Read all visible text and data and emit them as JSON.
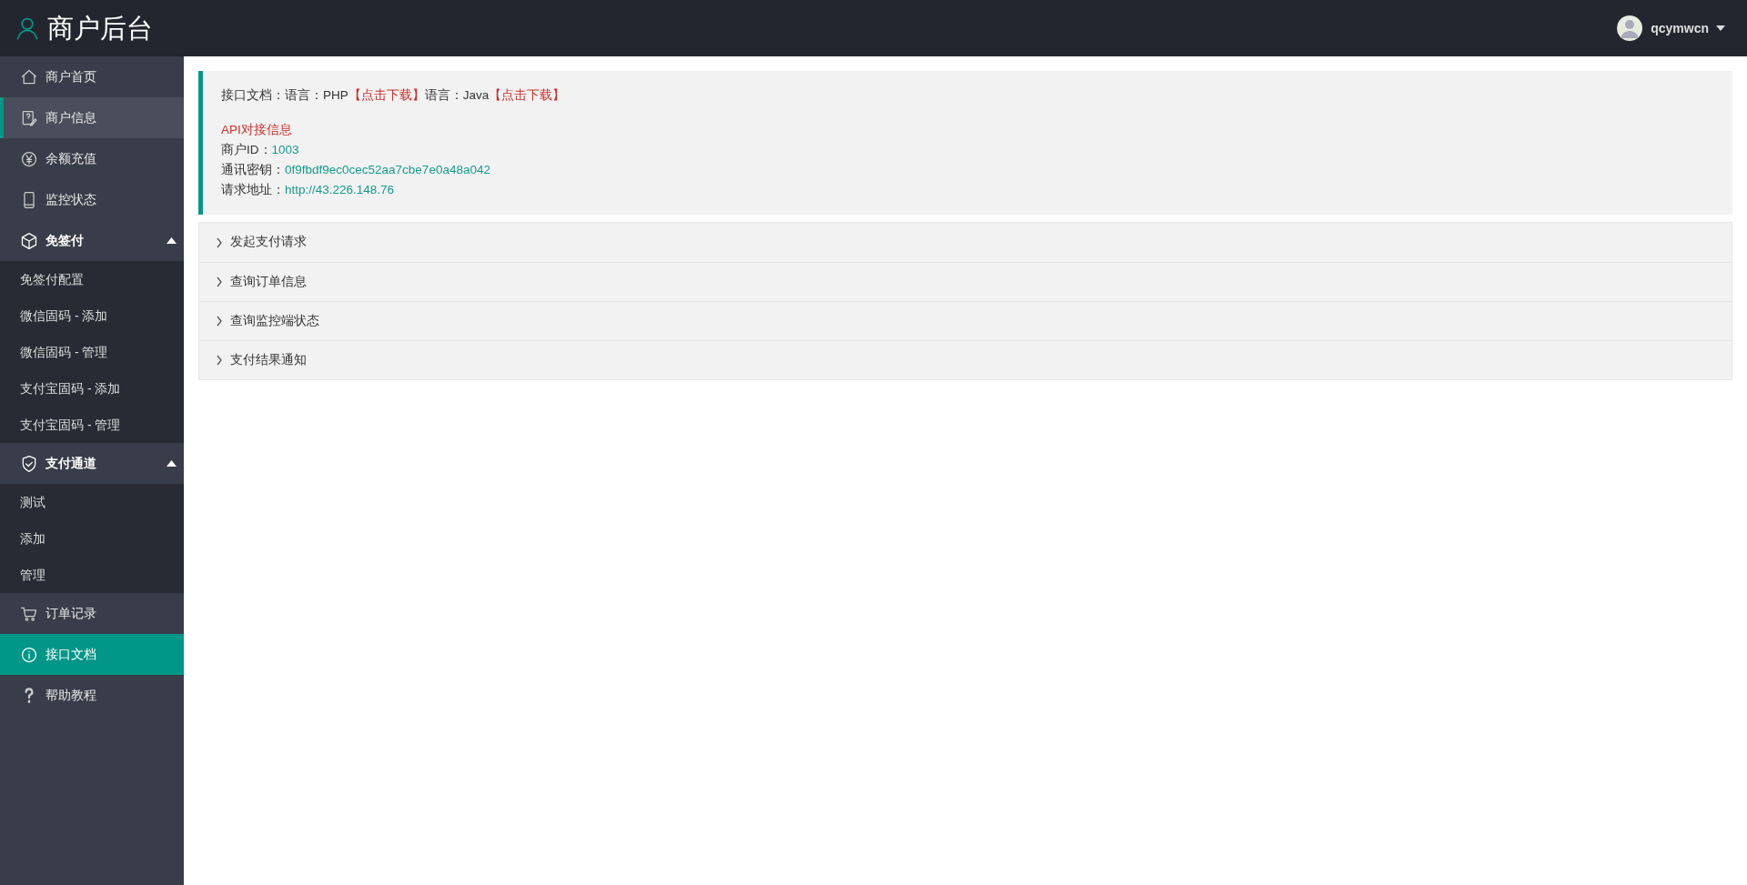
{
  "header": {
    "title": "商户后台",
    "user": {
      "name": "qcymwcn"
    }
  },
  "sidebar": {
    "items": [
      {
        "kind": "link",
        "label": "商户首页",
        "selected": false,
        "hovered": false
      },
      {
        "kind": "link",
        "label": "商户信息",
        "selected": false,
        "hovered": true
      },
      {
        "kind": "link",
        "label": "余额充值",
        "selected": false,
        "hovered": false
      },
      {
        "kind": "link",
        "label": "监控状态",
        "selected": false,
        "hovered": false
      },
      {
        "kind": "group",
        "label": "免签付",
        "expanded": true,
        "children": [
          {
            "label": "免签付配置"
          },
          {
            "label": "微信固码 - 添加"
          },
          {
            "label": "微信固码 - 管理"
          },
          {
            "label": "支付宝固码 - 添加"
          },
          {
            "label": "支付宝固码 - 管理"
          }
        ]
      },
      {
        "kind": "group",
        "label": "支付通道",
        "expanded": true,
        "children": [
          {
            "label": "测试"
          },
          {
            "label": "添加"
          },
          {
            "label": "管理"
          }
        ]
      },
      {
        "kind": "link",
        "label": "订单记录",
        "selected": false,
        "hovered": false
      },
      {
        "kind": "link",
        "label": "接口文档",
        "selected": true,
        "hovered": false
      },
      {
        "kind": "link",
        "label": "帮助教程",
        "selected": false,
        "hovered": false
      }
    ]
  },
  "info": {
    "doc_line": [
      {
        "kind": "text",
        "text": "接口文档：语言：PHP"
      },
      {
        "kind": "link",
        "text": "【点击下载】"
      },
      {
        "kind": "text",
        "text": "语言：Java"
      },
      {
        "kind": "link",
        "text": "【点击下载】"
      }
    ],
    "api_title": "API对接信息",
    "fields": [
      {
        "label": "商户ID：",
        "value": "1003"
      },
      {
        "label": "通讯密钥：",
        "value": "0f9fbdf9ec0cec52aa7cbe7e0a48a042"
      },
      {
        "label": "请求地址：",
        "value": "http://43.226.148.76"
      }
    ]
  },
  "accordion": [
    {
      "title": "发起支付请求",
      "expanded": false
    },
    {
      "title": "查询订单信息",
      "expanded": false
    },
    {
      "title": "查询监控端状态",
      "expanded": false
    },
    {
      "title": "支付结果通知",
      "expanded": false
    }
  ]
}
